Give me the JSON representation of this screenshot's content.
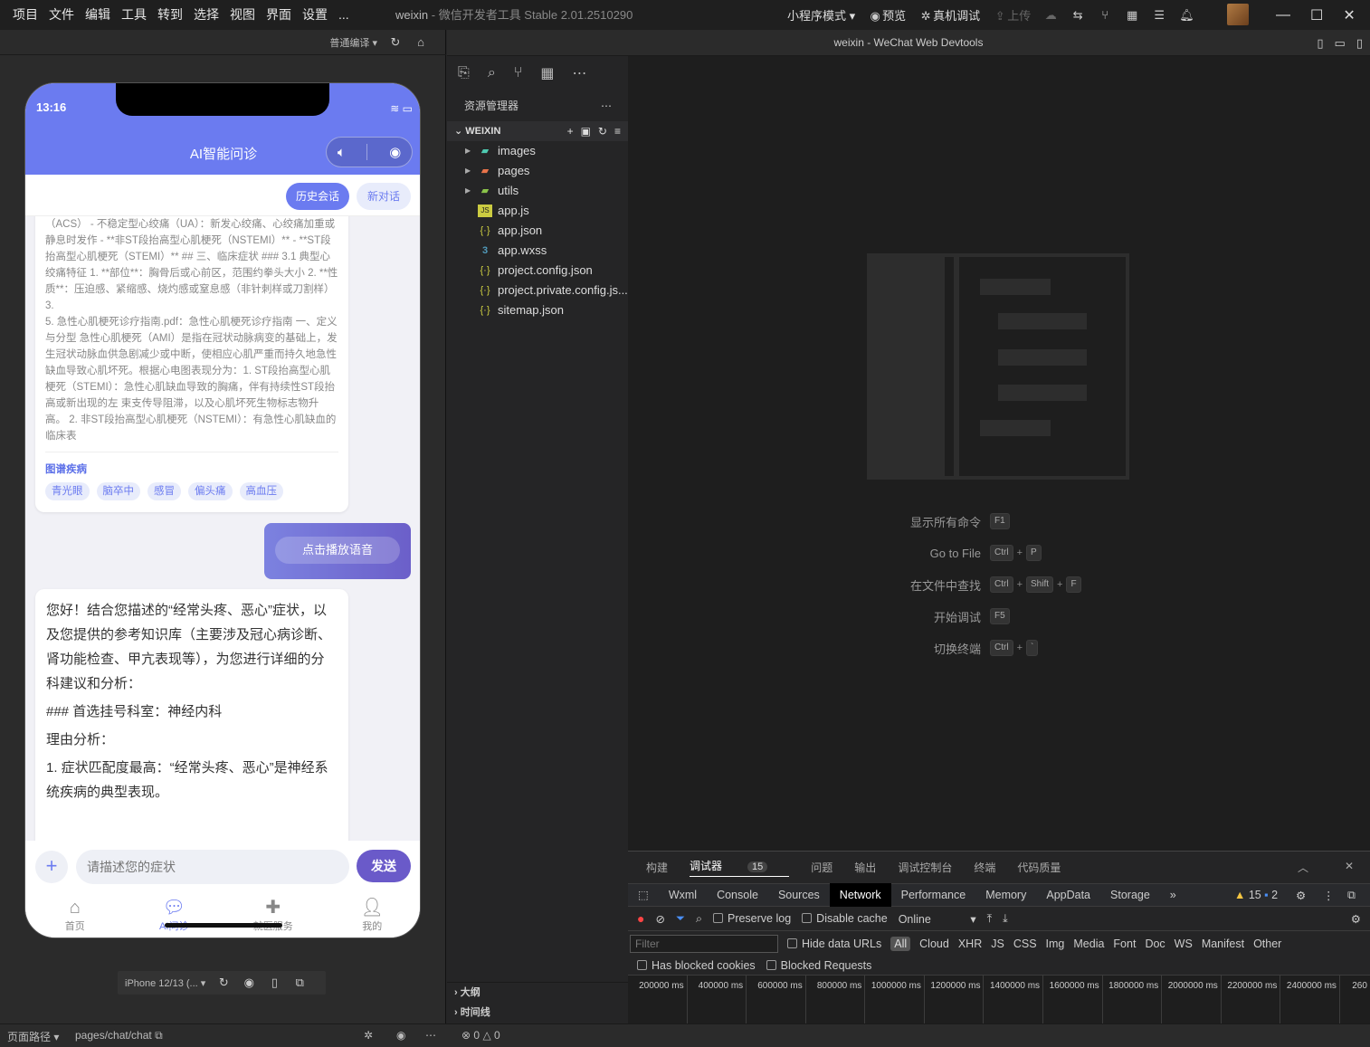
{
  "menubar": {
    "items": [
      "项目",
      "文件",
      "编辑",
      "工具",
      "转到",
      "选择",
      "视图",
      "界面",
      "设置",
      "..."
    ]
  },
  "app_title": {
    "name": "weixin",
    "sep": " - ",
    "product": "微信开发者工具 Stable 2.01.2510290"
  },
  "toolbar": {
    "mode": "小程序模式",
    "preview": "预览",
    "real_debug": "真机调试",
    "upload": "上传"
  },
  "simulator": {
    "compile_mode": "普通编译",
    "status_time": "13:16",
    "nav_title": "AI智能问诊",
    "history_btn": "历史会话",
    "new_chat_btn": "新对话",
    "ref_text_1": "（ACS） - 不稳定型心绞痛（UA）：新发心绞痛、心绞痛加重或静息时发作 - **非ST段抬高型心肌梗死（NSTEMI）** - **ST段抬高型心肌梗死（STEMI）** ## 三、临床症状 ### 3.1 典型心绞痛特征 1. **部位**：胸骨后或心前区，范围约拳头大小 2. **性质**：压迫感、紧缩感、烧灼感或窒息感（非针刺样或刀割样） 3.",
    "ref_text_2": "5. 急性心肌梗死诊疗指南.pdf：急性心肌梗死诊疗指南 一、定义与分型 急性心肌梗死（AMI）是指在冠状动脉病变的基础上，发生冠状动脉血供急剧减少或中断，使相应心肌严重而持久地急性缺血导致心肌坏死。根据心电图表现分为：1. ST段抬高型心肌梗死（STEMI）：急性心肌缺血导致的胸痛，伴有持续性ST段抬高或新出现的左 束支传导阻滞，以及心肌坏死生物标志物升高。 2. 非ST段抬高型心肌梗死（NSTEMI）：有急性心肌缺血的临床表",
    "graph_title": "图谱疾病",
    "tags": [
      "青光眼",
      "脑卒中",
      "感冒",
      "偏头痛",
      "高血压"
    ],
    "voice_btn": "点击播放语音",
    "answer": {
      "p1": "您好！结合您描述的“经常头疼、恶心”症状，以及您提供的参考知识库（主要涉及冠心病诊断、肾功能检查、甲亢表现等），为您进行详细的分科建议和分析：",
      "p2": "### 首选挂号科室：神经内科",
      "p3": "理由分析：",
      "p4": "1. 症状匹配度最高：“经常头疼、恶心”是神经系统疾病的典型表现。"
    },
    "input_placeholder": "请描述您的症状",
    "send_btn": "发送",
    "tabs": [
      "首页",
      "AI问诊",
      "就医服务",
      "我的"
    ],
    "device": "iPhone 12/13 (..."
  },
  "explorer": {
    "title": "资源管理器",
    "workspace": "WEIXIN",
    "files": [
      {
        "name": "images",
        "type": "folder"
      },
      {
        "name": "pages",
        "type": "folder"
      },
      {
        "name": "utils",
        "type": "folder"
      },
      {
        "name": "app.js",
        "type": "js"
      },
      {
        "name": "app.json",
        "type": "json"
      },
      {
        "name": "app.wxss",
        "type": "wxss"
      },
      {
        "name": "project.config.json",
        "type": "json"
      },
      {
        "name": "project.private.config.js...",
        "type": "json"
      },
      {
        "name": "sitemap.json",
        "type": "json"
      }
    ],
    "outline": "大纲",
    "timeline": "时间线"
  },
  "editor": {
    "title": "weixin - WeChat Web Devtools",
    "commands": [
      {
        "label": "显示所有命令",
        "keys": [
          "F1"
        ]
      },
      {
        "label": "Go to File",
        "keys": [
          "Ctrl",
          "P"
        ]
      },
      {
        "label": "在文件中查找",
        "keys": [
          "Ctrl",
          "Shift",
          "F"
        ]
      },
      {
        "label": "开始调试",
        "keys": [
          "F5"
        ]
      },
      {
        "label": "切换终端",
        "keys": [
          "Ctrl",
          "`"
        ]
      }
    ]
  },
  "devtools": {
    "top_tabs": [
      "构建",
      "调试器",
      "问题",
      "输出",
      "调试控制台",
      "终端",
      "代码质量"
    ],
    "debugger_count": "15",
    "panels": [
      "Wxml",
      "Console",
      "Sources",
      "Network",
      "Performance",
      "Memory",
      "AppData",
      "Storage"
    ],
    "warn_count": "15",
    "info_count": "2",
    "preserve_log": "Preserve log",
    "disable_cache": "Disable cache",
    "throttle": "Online",
    "filter_placeholder": "Filter",
    "hide_data_urls": "Hide data URLs",
    "type_filters": [
      "All",
      "Cloud",
      "XHR",
      "JS",
      "CSS",
      "Img",
      "Media",
      "Font",
      "Doc",
      "WS",
      "Manifest",
      "Other"
    ],
    "has_blocked_cookies": "Has blocked cookies",
    "blocked_requests": "Blocked Requests",
    "ticks": [
      "200000 ms",
      "400000 ms",
      "600000 ms",
      "800000 ms",
      "1000000 ms",
      "1200000 ms",
      "1400000 ms",
      "1600000 ms",
      "1800000 ms",
      "2000000 ms",
      "2200000 ms",
      "2400000 ms",
      "260"
    ]
  },
  "statusbar": {
    "path_label": "页面路径",
    "path": "pages/chat/chat",
    "errors": "0",
    "warnings": "0"
  },
  "colors": {
    "accent": "#6b7bf0",
    "send": "#6a5ac9"
  }
}
